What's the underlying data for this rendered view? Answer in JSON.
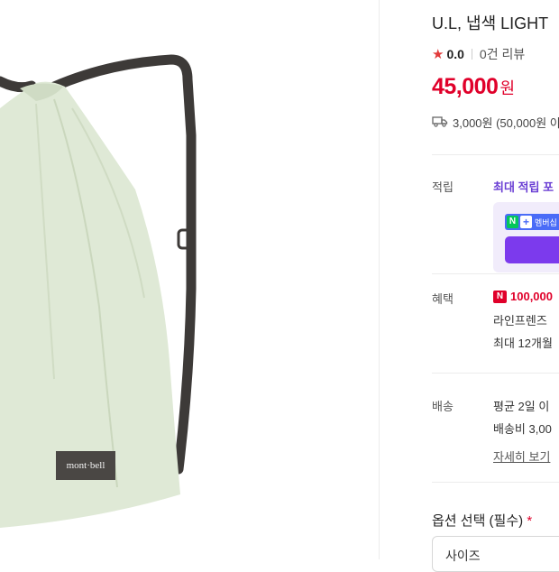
{
  "product": {
    "title": "U.L, 냅색 LIGHT",
    "rating": "0.0",
    "review_count": "0건 리뷰",
    "price": "45,000",
    "currency": "원",
    "shipping": "3,000원 (50,000원 이",
    "image_brand_logo": "mont·bell"
  },
  "points": {
    "label": "적립",
    "max_text": "최대 적립 포",
    "badge_text": "멤버십"
  },
  "benefits": {
    "label": "혜택",
    "amount": "100,000",
    "line2": "라인프렌즈",
    "line3": "최대 12개월"
  },
  "delivery": {
    "label": "배송",
    "line1": "평균 2일 이",
    "line2": "배송비 3,00",
    "detail_link": "자세히 보기"
  },
  "options": {
    "title": "옵션 선택 (필수)",
    "required_mark": "*",
    "select_value": "사이즈"
  },
  "colors": {
    "price_red": "#e0002a",
    "accent_purple": "#7c3aed",
    "naver_green": "#03c75a",
    "bag_mint": "#dfe9d6"
  }
}
